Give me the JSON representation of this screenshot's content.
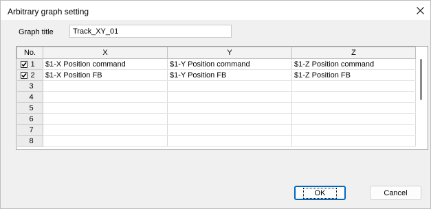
{
  "window": {
    "title": "Arbitrary graph setting",
    "close_icon": "close-icon"
  },
  "graph_title": {
    "label": "Graph title",
    "value": "Track_XY_01"
  },
  "grid": {
    "columns": [
      "No.",
      "X",
      "Y",
      "Z"
    ],
    "rows": [
      {
        "no": "1",
        "checked": true,
        "x": "$1-X Position command",
        "y": "$1-Y Position command",
        "z": "$1-Z Position command"
      },
      {
        "no": "2",
        "checked": true,
        "x": "$1-X Position FB",
        "y": "$1-Y Position FB",
        "z": "$1-Z Position FB"
      },
      {
        "no": "3",
        "x": "",
        "y": "",
        "z": ""
      },
      {
        "no": "4",
        "x": "",
        "y": "",
        "z": ""
      },
      {
        "no": "5",
        "x": "",
        "y": "",
        "z": ""
      },
      {
        "no": "6",
        "x": "",
        "y": "",
        "z": ""
      },
      {
        "no": "7",
        "x": "",
        "y": "",
        "z": ""
      },
      {
        "no": "8",
        "x": "",
        "y": "",
        "z": ""
      }
    ]
  },
  "buttons": {
    "ok": "OK",
    "cancel": "Cancel"
  },
  "colors": {
    "accent": "#0067c0"
  }
}
